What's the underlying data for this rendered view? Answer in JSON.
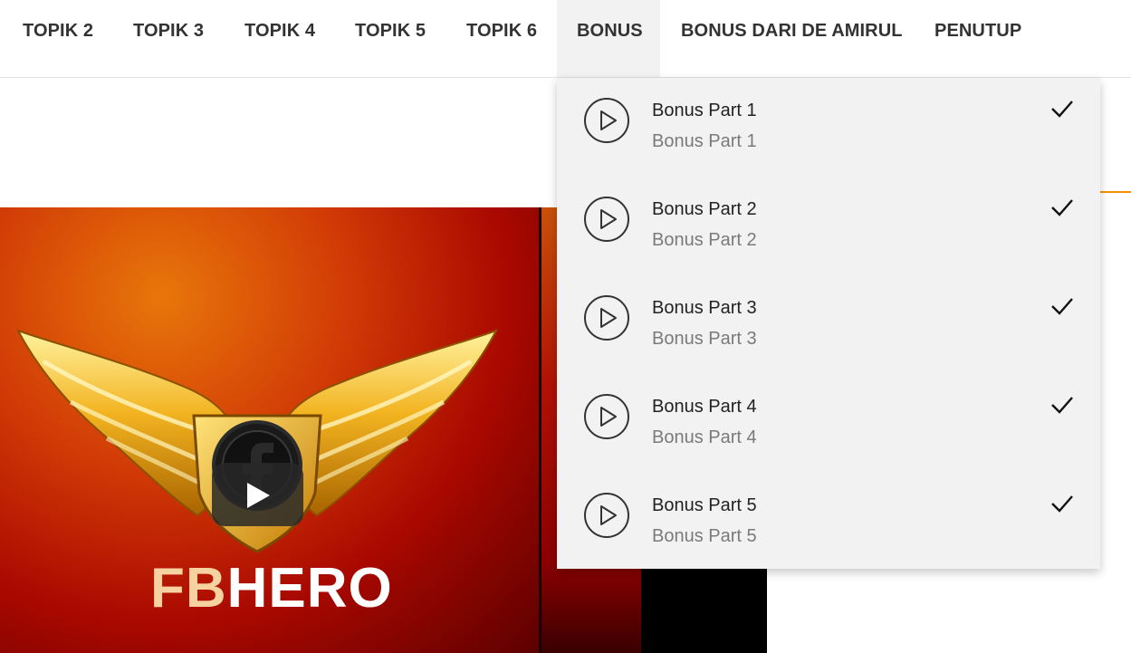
{
  "nav": {
    "items": [
      {
        "label": "TOPIK 2"
      },
      {
        "label": "TOPIK 3"
      },
      {
        "label": "TOPIK 4"
      },
      {
        "label": "TOPIK 5"
      },
      {
        "label": "TOPIK 6"
      },
      {
        "label": "BONUS",
        "active": true
      },
      {
        "label": "BONUS DARI DE AMIRUL"
      },
      {
        "label": "PENUTUP"
      }
    ]
  },
  "dropdown": {
    "items": [
      {
        "title": "Bonus Part 1",
        "subtitle": "Bonus Part 1",
        "icon": "play-circle-icon",
        "status_icon": "checkmark-icon"
      },
      {
        "title": "Bonus Part 2",
        "subtitle": "Bonus Part 2",
        "icon": "play-circle-icon",
        "status_icon": "checkmark-icon"
      },
      {
        "title": "Bonus Part 3",
        "subtitle": "Bonus Part 3",
        "icon": "play-circle-icon",
        "status_icon": "checkmark-icon"
      },
      {
        "title": "Bonus Part 4",
        "subtitle": "Bonus Part 4",
        "icon": "play-circle-icon",
        "status_icon": "checkmark-icon"
      },
      {
        "title": "Bonus Part 5",
        "subtitle": "Bonus Part 5",
        "icon": "play-circle-icon",
        "status_icon": "checkmark-icon"
      }
    ]
  },
  "video": {
    "logo_text_fb": "FB",
    "logo_text_hero": "HERO",
    "play_icon": "play-icon"
  },
  "colors": {
    "accent": "#f39200",
    "nav_text": "#333333",
    "dropdown_bg": "#f2f2f2"
  }
}
